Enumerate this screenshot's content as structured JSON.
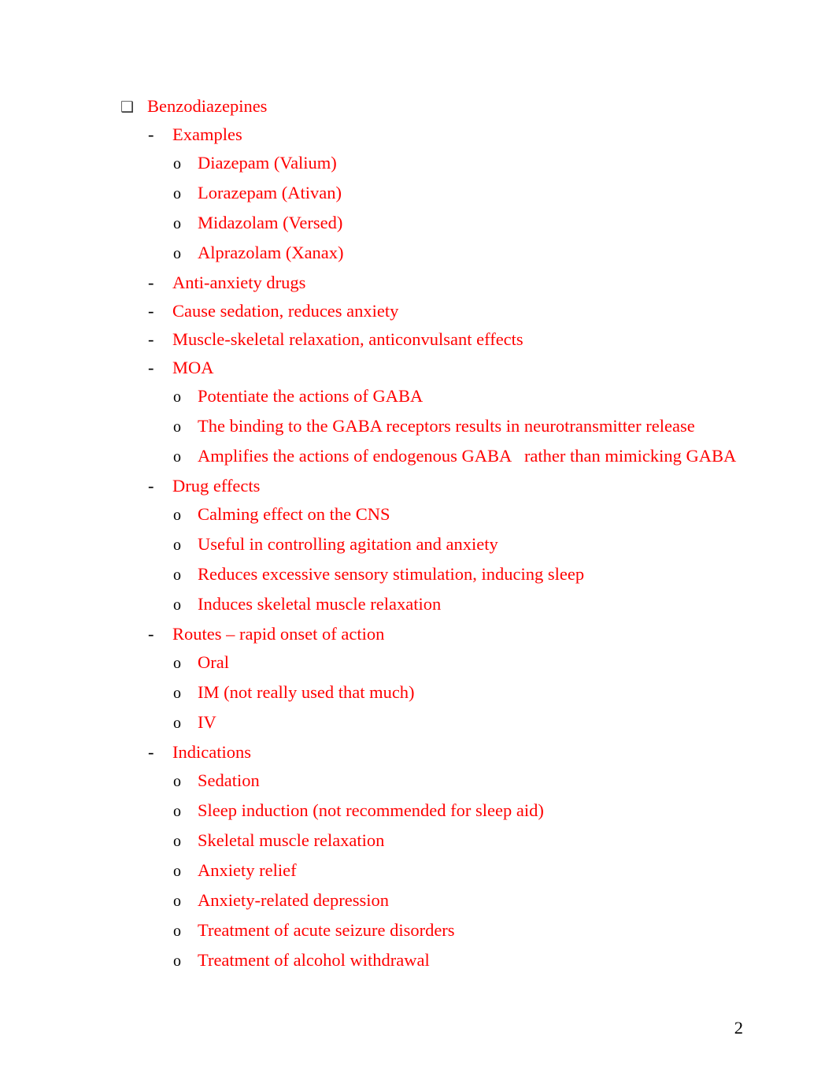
{
  "document": {
    "page_number": "2",
    "text_color": "#ff0000",
    "marker_color": "#000000",
    "background_color": "#ffffff"
  },
  "markers": {
    "level1": "❑",
    "level2": "-",
    "level3": "o"
  },
  "outline": [
    {
      "level": 1,
      "marker": "❑",
      "text": "Benzodiazepines"
    },
    {
      "level": 2,
      "marker": "-",
      "text": "Examples"
    },
    {
      "level": 3,
      "marker": "o",
      "text": "Diazepam (Valium)"
    },
    {
      "level": 3,
      "marker": "o",
      "text": "Lorazepam (Ativan)"
    },
    {
      "level": 3,
      "marker": "o",
      "text": "Midazolam (Versed)"
    },
    {
      "level": 3,
      "marker": "o",
      "text": "Alprazolam (Xanax)"
    },
    {
      "level": 2,
      "marker": "-",
      "text": "Anti-anxiety drugs"
    },
    {
      "level": 2,
      "marker": "-",
      "text": "Cause sedation, reduces anxiety"
    },
    {
      "level": 2,
      "marker": "-",
      "text": "Muscle-skeletal relaxation, anticonvulsant effects"
    },
    {
      "level": 2,
      "marker": "-",
      "text": "MOA"
    },
    {
      "level": 3,
      "marker": "o",
      "text": "Potentiate the actions of GABA"
    },
    {
      "level": 3,
      "marker": "o",
      "text": "The binding to the GABA receptors results in neurotransmitter release"
    },
    {
      "level": 3,
      "marker": "o",
      "text": "Amplifies the actions of endogenous GABA   rather than mimicking GABA"
    },
    {
      "level": 2,
      "marker": "-",
      "text": "Drug effects"
    },
    {
      "level": 3,
      "marker": "o",
      "text": "Calming effect on the CNS"
    },
    {
      "level": 3,
      "marker": "o",
      "text": "Useful in controlling agitation and anxiety"
    },
    {
      "level": 3,
      "marker": "o",
      "text": "Reduces excessive sensory stimulation, inducing sleep"
    },
    {
      "level": 3,
      "marker": "o",
      "text": "Induces skeletal muscle relaxation"
    },
    {
      "level": 2,
      "marker": "-",
      "text": "Routes – rapid onset of action"
    },
    {
      "level": 3,
      "marker": "o",
      "text": "Oral"
    },
    {
      "level": 3,
      "marker": "o",
      "text": "IM (not really used that much)"
    },
    {
      "level": 3,
      "marker": "o",
      "text": "IV"
    },
    {
      "level": 2,
      "marker": "-",
      "text": "Indications"
    },
    {
      "level": 3,
      "marker": "o",
      "text": "Sedation"
    },
    {
      "level": 3,
      "marker": "o",
      "text": "Sleep induction (not recommended for sleep aid)"
    },
    {
      "level": 3,
      "marker": "o",
      "text": "Skeletal muscle relaxation"
    },
    {
      "level": 3,
      "marker": "o",
      "text": "Anxiety relief"
    },
    {
      "level": 3,
      "marker": "o",
      "text": "Anxiety-related depression"
    },
    {
      "level": 3,
      "marker": "o",
      "text": "Treatment of acute seizure disorders"
    },
    {
      "level": 3,
      "marker": "o",
      "text": "Treatment of alcohol withdrawal"
    }
  ]
}
